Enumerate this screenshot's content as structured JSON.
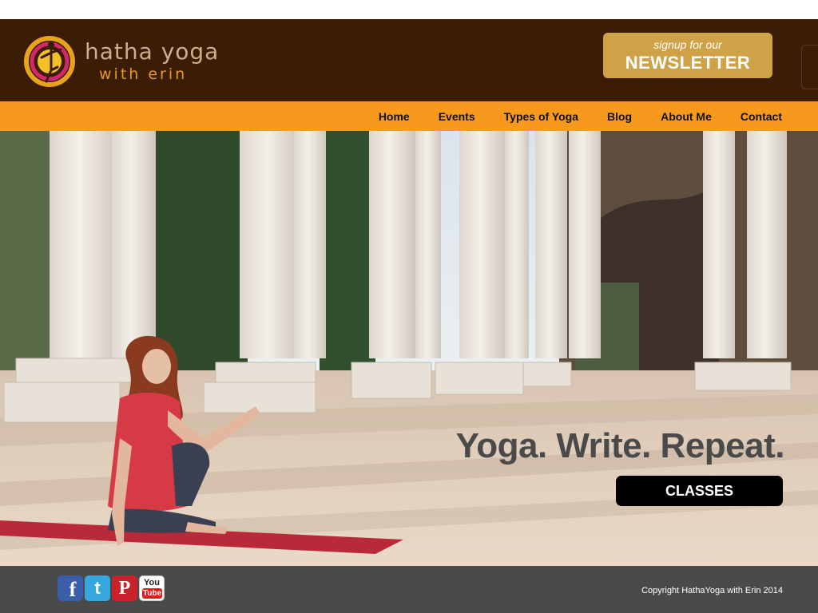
{
  "brand": {
    "name_line1": "hatha yoga",
    "name_line2": "with erin"
  },
  "newsletter": {
    "small_label": "signup for our",
    "big_label": "NEWSLETTER"
  },
  "nav": {
    "items": [
      {
        "label": "Home"
      },
      {
        "label": "Events"
      },
      {
        "label": "Types of Yoga"
      },
      {
        "label": "Blog"
      },
      {
        "label": "About Me"
      },
      {
        "label": "Contact"
      }
    ]
  },
  "hero": {
    "tagline": "Yoga. Write. Repeat.",
    "cta_label": "CLASSES"
  },
  "footer": {
    "social": [
      {
        "name": "facebook-icon",
        "glyph": "f"
      },
      {
        "name": "twitter-icon",
        "glyph": "t"
      },
      {
        "name": "pinterest-icon",
        "glyph": "P"
      },
      {
        "name": "youtube-icon",
        "glyph_top": "You",
        "glyph_bottom": "Tube"
      }
    ],
    "copyright": "Copyright HathaYoga with Erin 2014"
  },
  "colors": {
    "header_bg": "#3b1c05",
    "nav_bg": "#f7991c",
    "newsletter_bg": "#cfa248",
    "footer_bg": "#4a4a4a",
    "cta_bg": "#000000"
  }
}
